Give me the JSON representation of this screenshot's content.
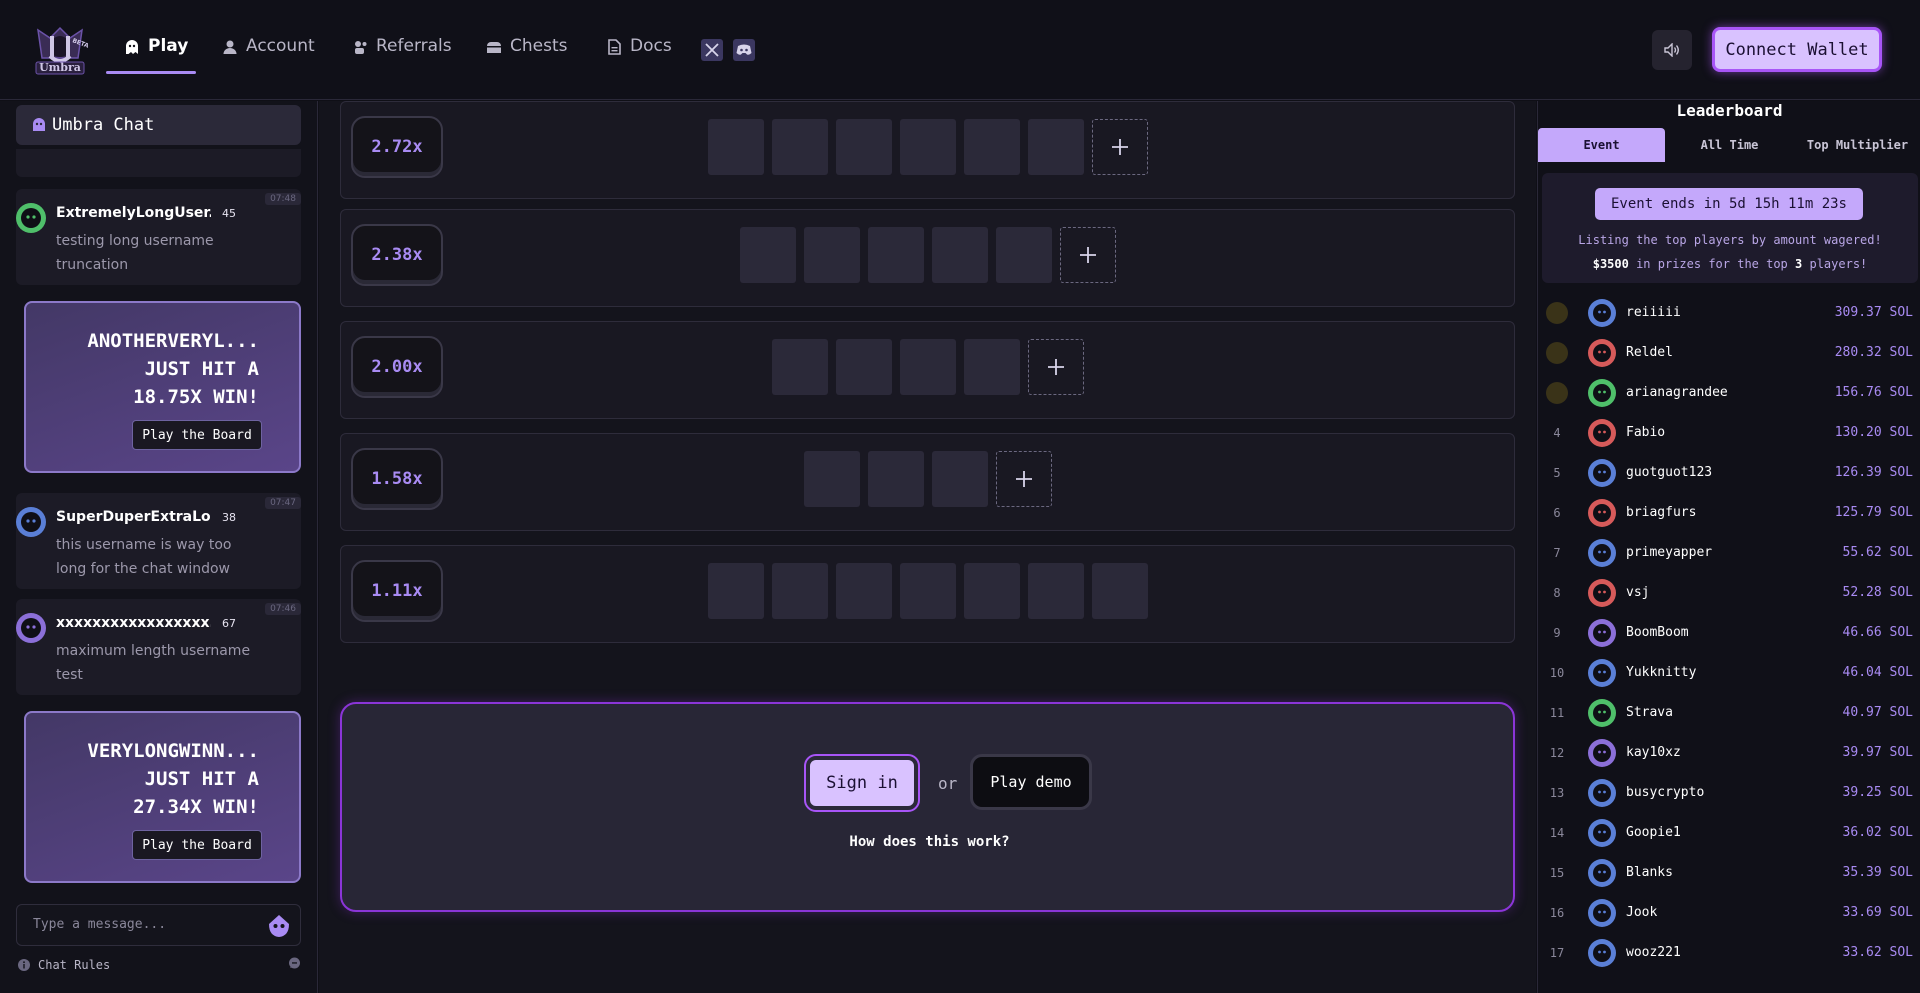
{
  "header": {
    "logo_text": "Umbra",
    "logo_badge": "BETA",
    "nav": [
      {
        "label": "Play",
        "icon": "ghost-icon"
      },
      {
        "label": "Account",
        "icon": "user-icon"
      },
      {
        "label": "Referrals",
        "icon": "referral-icon"
      },
      {
        "label": "Chests",
        "icon": "chest-icon"
      },
      {
        "label": "Docs",
        "icon": "document-icon"
      }
    ],
    "connect_label": "Connect Wallet"
  },
  "chat": {
    "title": "Umbra Chat",
    "messages": [
      {
        "user": "ExtremelyLongUser...",
        "level": "45",
        "time": "07:48",
        "text": "testing long username truncation",
        "color": "#4fbf6a"
      },
      {
        "user": "SuperDuperExtraLo...",
        "level": "38",
        "time": "07:47",
        "text": "this username is way too long for the chat window",
        "color": "#5a7fd6"
      },
      {
        "user": "xxxxxxxxxxxxxxxxx...",
        "level": "67",
        "time": "07:46",
        "text": "maximum length username test",
        "color": "#8b6fd8"
      }
    ],
    "wins": [
      {
        "line1": "ANOTHERVERYL...",
        "line2": "JUST HIT A",
        "line3": "18.75X WIN!",
        "button": "Play the Board"
      },
      {
        "line1": "VERYLONGWINN...",
        "line2": "JUST HIT A",
        "line3": "27.34X WIN!",
        "button": "Play the Board"
      }
    ],
    "input_placeholder": "Type a message...",
    "rules_label": "Chat Rules"
  },
  "board": {
    "rows": [
      {
        "multiplier": "2.72x",
        "tiles": 6,
        "plus": true
      },
      {
        "multiplier": "2.38x",
        "tiles": 5,
        "plus": true
      },
      {
        "multiplier": "2.00x",
        "tiles": 4,
        "plus": true
      },
      {
        "multiplier": "1.58x",
        "tiles": 3,
        "plus": true
      },
      {
        "multiplier": "1.11x",
        "tiles": 7,
        "plus": false
      }
    ],
    "signin_label": "Sign in",
    "or_label": "or",
    "demo_label": "Play demo",
    "how_label": "How does this work?"
  },
  "leaderboard": {
    "title": "Leaderboard",
    "tabs": [
      "Event",
      "All Time",
      "Top Multiplier"
    ],
    "event_timer": "Event ends in 5d 15h 11m 23s",
    "event_desc": "Listing the top players by amount wagered!",
    "prize_amount": "$3500",
    "prize_mid": " in prizes for the top ",
    "prize_count": "3",
    "prize_end": " players!",
    "entries": [
      {
        "rank": "1",
        "name": "reiiiii",
        "amount": "309.37 SOL",
        "color": "#5a7fd6"
      },
      {
        "rank": "2",
        "name": "Reldel",
        "amount": "280.32 SOL",
        "color": "#d65a5a"
      },
      {
        "rank": "3",
        "name": "arianagrandee",
        "amount": "156.76 SOL",
        "color": "#4fbf6a"
      },
      {
        "rank": "4",
        "name": "Fabio",
        "amount": "130.20 SOL",
        "color": "#d65a5a"
      },
      {
        "rank": "5",
        "name": "guotguot123",
        "amount": "126.39 SOL",
        "color": "#5a7fd6"
      },
      {
        "rank": "6",
        "name": "briagfurs",
        "amount": "125.79 SOL",
        "color": "#d65a5a"
      },
      {
        "rank": "7",
        "name": "primeyapper",
        "amount": "55.62 SOL",
        "color": "#5a7fd6"
      },
      {
        "rank": "8",
        "name": "vsj",
        "amount": "52.28 SOL",
        "color": "#d65a5a"
      },
      {
        "rank": "9",
        "name": "BoomBoom",
        "amount": "46.66 SOL",
        "color": "#8b6fd8"
      },
      {
        "rank": "10",
        "name": "Yukknitty",
        "amount": "46.04 SOL",
        "color": "#5a7fd6"
      },
      {
        "rank": "11",
        "name": "Strava",
        "amount": "40.97 SOL",
        "color": "#4fbf6a"
      },
      {
        "rank": "12",
        "name": "kay10xz",
        "amount": "39.97 SOL",
        "color": "#8b6fd8"
      },
      {
        "rank": "13",
        "name": "busycrypto",
        "amount": "39.25 SOL",
        "color": "#5a7fd6"
      },
      {
        "rank": "14",
        "name": "Goopie1",
        "amount": "36.02 SOL",
        "color": "#5a7fd6"
      },
      {
        "rank": "15",
        "name": "Blanks",
        "amount": "35.39 SOL",
        "color": "#5a7fd6"
      },
      {
        "rank": "16",
        "name": "Jook",
        "amount": "33.69 SOL",
        "color": "#5a7fd6"
      },
      {
        "rank": "17",
        "name": "wooz221",
        "amount": "33.62 SOL",
        "color": "#5a7fd6"
      }
    ]
  },
  "colors": {
    "accent": "#a98bf3",
    "brand": "#a855f7",
    "button_light": "#d9c2ff"
  }
}
